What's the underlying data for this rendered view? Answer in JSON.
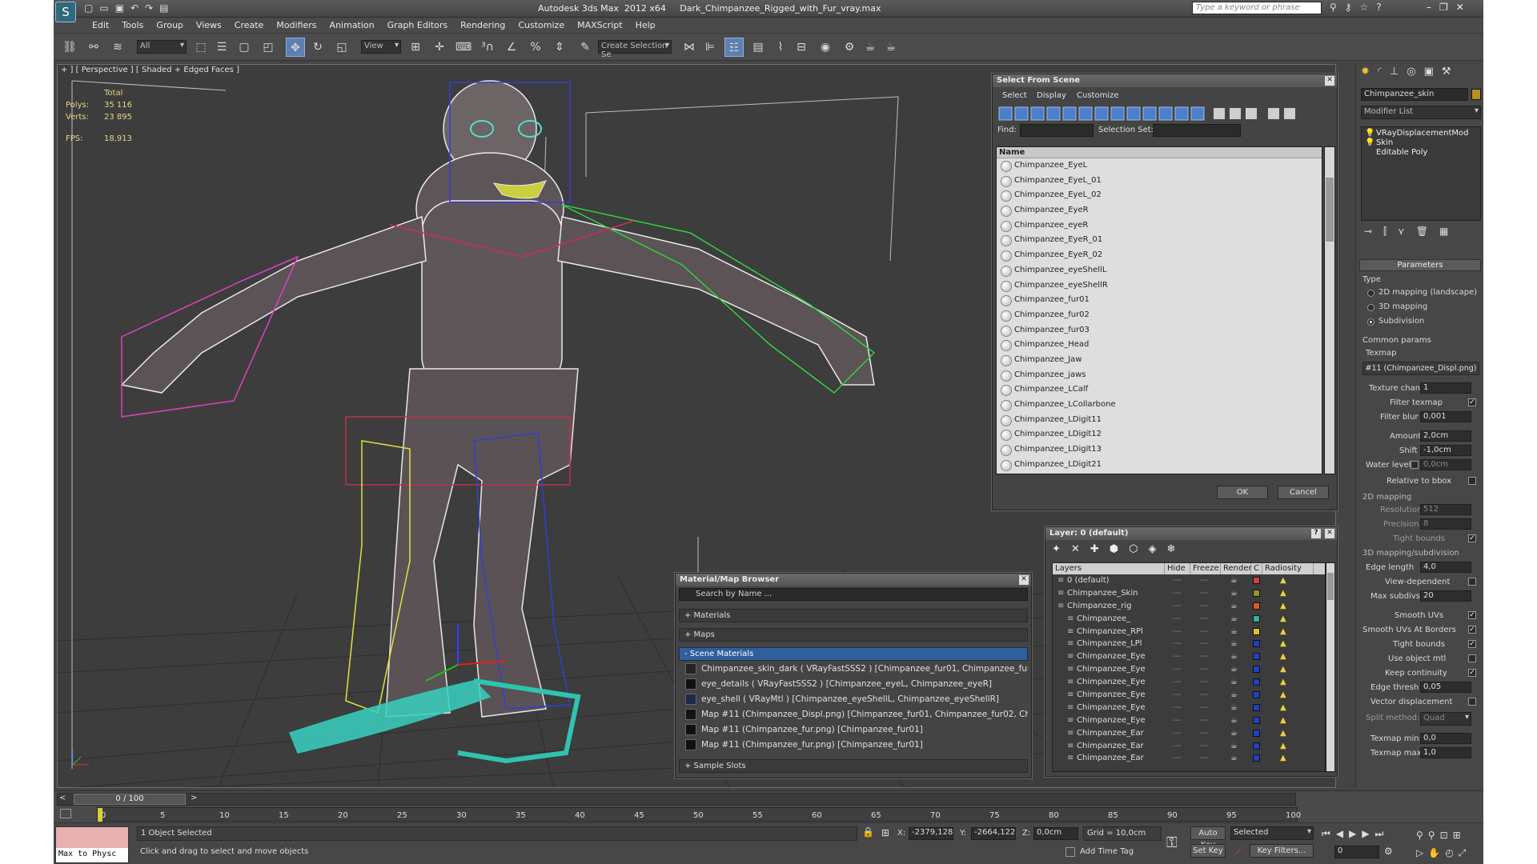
{
  "window": {
    "title": "Autodesk 3ds Max  2012 x64     Dark_Chimpanzee_Rigged_with_Fur_vray.max"
  },
  "search": {
    "placeholder": "Type a keyword or phrase"
  },
  "menu": [
    "Edit",
    "Tools",
    "Group",
    "Views",
    "Create",
    "Modifiers",
    "Animation",
    "Graph Editors",
    "Rendering",
    "Customize",
    "MAXScript",
    "Help"
  ],
  "toolbar": {
    "filter_value": "All",
    "refcoord_value": "View",
    "selection_set_placeholder": "Create Selection Se"
  },
  "viewport": {
    "label": "+ ] [ Perspective ] [ Shaded + Edged Faces ]",
    "stats": {
      "total_label": "Total",
      "polys_label": "Polys:",
      "polys_value": "35 116",
      "verts_label": "Verts:",
      "verts_value": "23 895",
      "fps_label": "FPS:",
      "fps_value": "18,913"
    }
  },
  "select_from_scene": {
    "title": "Select From Scene",
    "menu": [
      "Select",
      "Display",
      "Customize"
    ],
    "find_label": "Find:",
    "selection_set_label": "Selection Set:",
    "column_name": "Name",
    "items": [
      "Chimpanzee_EyeL",
      "Chimpanzee_EyeL_01",
      "Chimpanzee_EyeL_02",
      "Chimpanzee_EyeR",
      "Chimpanzee_eyeR",
      "Chimpanzee_EyeR_01",
      "Chimpanzee_EyeR_02",
      "Chimpanzee_eyeShellL",
      "Chimpanzee_eyeShellR",
      "Chimpanzee_fur01",
      "Chimpanzee_fur02",
      "Chimpanzee_fur03",
      "Chimpanzee_Head",
      "Chimpanzee_Jaw",
      "Chimpanzee_jaws",
      "Chimpanzee_LCalf",
      "Chimpanzee_LCollarbone",
      "Chimpanzee_LDigit11",
      "Chimpanzee_LDigit12",
      "Chimpanzee_LDigit13",
      "Chimpanzee_LDigit21"
    ],
    "ok_label": "OK",
    "cancel_label": "Cancel"
  },
  "material_browser": {
    "title": "Material/Map Browser",
    "search_placeholder": "Search by Name ...",
    "groups": [
      "+ Materials",
      "+ Maps",
      "- Scene Materials"
    ],
    "materials": [
      "Chimpanzee_skin_dark  ( VRayFastSSS2 )  [Chimpanzee_fur01, Chimpanzee_fur0...",
      "eye_details  ( VRayFastSSS2 )  [Chimpanzee_eyeL, Chimpanzee_eyeR]",
      "eye_shell  ( VRayMtl )  [Chimpanzee_eyeShellL, Chimpanzee_eyeShellR]",
      "Map #11 (Chimpanzee_Displ.png)  [Chimpanzee_fur01, Chimpanzee_fur02, Chim...",
      "Map #11 (Chimpanzee_fur.png)  [Chimpanzee_fur01]",
      "Map #11 (Chimpanzee_fur.png)  [Chimpanzee_fur01]"
    ],
    "sample_slots": "+ Sample Slots"
  },
  "layer_dialog": {
    "title": "Layer: 0 (default)",
    "columns": [
      "Layers",
      "Hide",
      "Freeze",
      "Render",
      "C",
      "Radiosity"
    ],
    "rows": [
      {
        "name": "0 (default)",
        "color": "#d04040"
      },
      {
        "name": "Chimpanzee_Skin",
        "color": "#8a9a2a"
      },
      {
        "name": "Chimpanzee_rig",
        "color": "#e05a20"
      },
      {
        "name": "Chimpanzee_",
        "color": "#30b0a0"
      },
      {
        "name": "Chimpanzee_RPl",
        "color": "#e0c020"
      },
      {
        "name": "Chimpanzee_LPl",
        "color": "#2040c0"
      },
      {
        "name": "Chimpanzee_Eye",
        "color": "#2040c0"
      },
      {
        "name": "Chimpanzee_Eye",
        "color": "#2040c0"
      },
      {
        "name": "Chimpanzee_Eye",
        "color": "#2040c0"
      },
      {
        "name": "Chimpanzee_Eye",
        "color": "#2040c0"
      },
      {
        "name": "Chimpanzee_Eye",
        "color": "#2040c0"
      },
      {
        "name": "Chimpanzee_Eye",
        "color": "#2040c0"
      },
      {
        "name": "Chimpanzee_Ear",
        "color": "#2040c0"
      },
      {
        "name": "Chimpanzee_Ear",
        "color": "#2040c0"
      },
      {
        "name": "Chimpanzee_Ear",
        "color": "#2040c0"
      }
    ]
  },
  "command_panel": {
    "object_name": "Chimpanzee_skin",
    "modifier_list": "Modifier List",
    "stack": [
      "VRayDisplacementMod",
      "Skin",
      "Editable Poly"
    ],
    "parameters_title": "Parameters",
    "type_label": "Type",
    "type_options": [
      "2D mapping (landscape)",
      "3D mapping",
      "Subdivision"
    ],
    "common_params": "Common params",
    "texmap_label": "Texmap",
    "texmap_value": "#11 (Chimpanzee_Displ.png)",
    "texture_chan_label": "Texture chan",
    "texture_chan_value": "1",
    "filter_texmap_label": "Filter texmap",
    "filter_blur_label": "Filter blur",
    "filter_blur_value": "0,001",
    "amount_label": "Amount",
    "amount_value": "2,0cm",
    "shift_label": "Shift",
    "shift_value": "-1,0cm",
    "water_level_label": "Water level",
    "water_level_value": "0,0cm",
    "relative_bbox_label": "Relative to bbox",
    "mapping2d_label": "2D mapping",
    "resolution_label": "Resolution",
    "resolution_value": "512",
    "precision_label": "Precision",
    "precision_value": "8",
    "tight_bounds_label": "Tight bounds",
    "mapping3d_label": "3D mapping/subdivision",
    "edge_length_label": "Edge length",
    "edge_length_value": "4,0",
    "view_dependent_label": "View-dependent",
    "max_subdivs_label": "Max subdivs",
    "max_subdivs_value": "20",
    "smooth_uvs_label": "Smooth UVs",
    "smooth_uvs_borders_label": "Smooth UVs At Borders",
    "tight_bounds2_label": "Tight bounds",
    "use_object_mtl_label": "Use object mtl",
    "keep_continuity_label": "Keep continuity",
    "edge_thresh_label": "Edge thresh",
    "edge_thresh_value": "0,05",
    "vector_displacement_label": "Vector displacement",
    "split_method_label": "Split method:",
    "split_method_value": "Quad",
    "texmap_min_label": "Texmap min:",
    "texmap_min_value": "0,0",
    "texmap_max_label": "Texmap max:",
    "texmap_max_value": "1,0"
  },
  "timeline": {
    "frame_label": "0 / 100",
    "ticks": [
      "0",
      "5",
      "10",
      "15",
      "20",
      "25",
      "30",
      "35",
      "40",
      "45",
      "50",
      "55",
      "60",
      "65",
      "70",
      "75",
      "80",
      "85",
      "90",
      "95",
      "100"
    ]
  },
  "status": {
    "maxscript_line": "Max to Physc",
    "objects_selected": "1 Object Selected",
    "prompt": "Click and drag to select and move objects",
    "x_label": "X:",
    "x_value": "-2379,128",
    "y_label": "Y:",
    "y_value": "-2664,122",
    "z_label": "Z:",
    "z_value": "0,0cm",
    "grid": "Grid = 10,0cm",
    "add_time_tag": "Add Time Tag",
    "auto_key": "Auto Key",
    "set_key": "Set Key",
    "selected_value": "Selected",
    "key_filters": "Key Filters...",
    "frame_value": "0"
  }
}
